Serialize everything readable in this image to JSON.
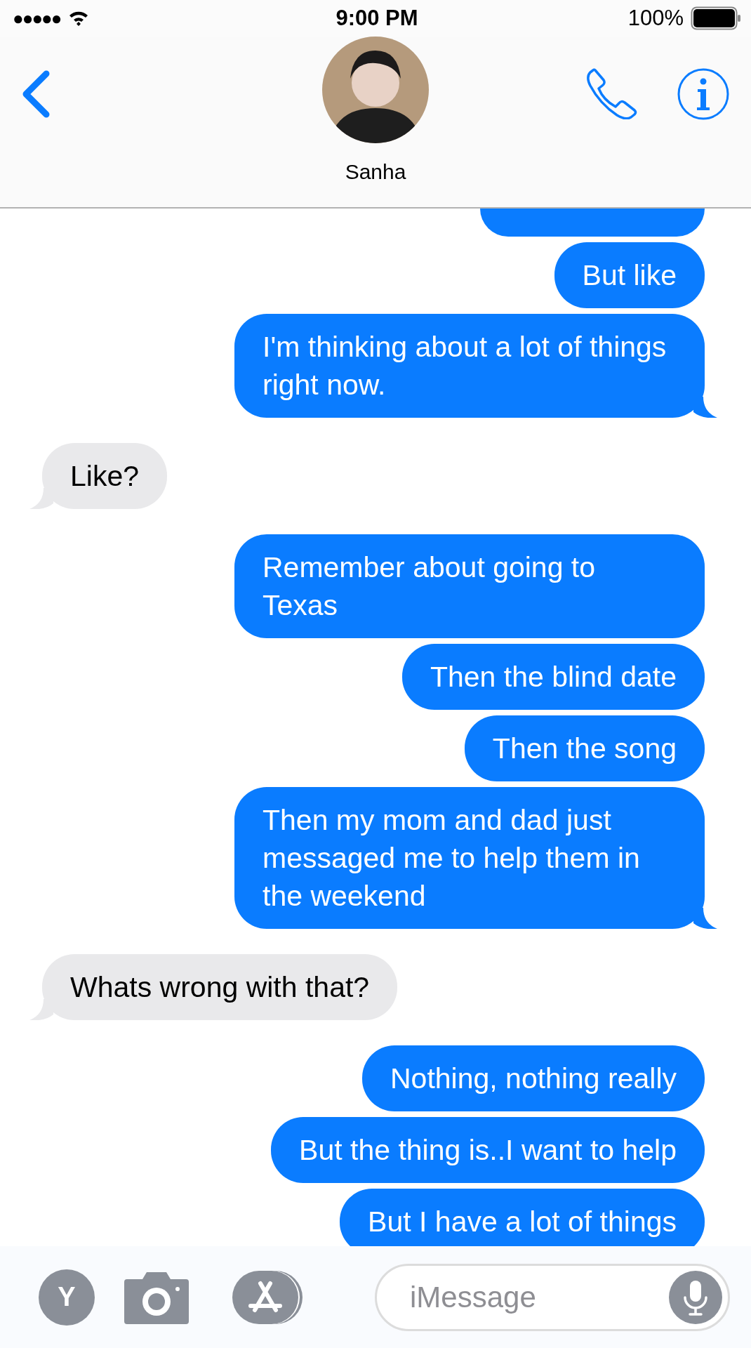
{
  "status_bar": {
    "signal_dots": "●●●●●",
    "time": "9:00 PM",
    "battery": "100%"
  },
  "header": {
    "contact_name": "Sanha"
  },
  "messages": [
    {
      "outgoing": true,
      "kind": "clipped",
      "tail": false
    },
    {
      "outgoing": true,
      "kind": "text",
      "text": "But like",
      "tail": false
    },
    {
      "outgoing": true,
      "kind": "text",
      "text": "I'm thinking about a lot of things right now.",
      "tail": true
    },
    {
      "outgoing": false,
      "kind": "text",
      "text": "Like?",
      "tail": true
    },
    {
      "outgoing": true,
      "kind": "text",
      "text": "Remember about going to Texas",
      "tail": false
    },
    {
      "outgoing": true,
      "kind": "text",
      "text": "Then the blind date",
      "tail": false
    },
    {
      "outgoing": true,
      "kind": "text",
      "text": "Then the song",
      "tail": false
    },
    {
      "outgoing": true,
      "kind": "text",
      "text": "Then my mom and dad just messaged me to help them in the weekend",
      "tail": true
    },
    {
      "outgoing": false,
      "kind": "text",
      "text": "Whats wrong with that?",
      "tail": true
    },
    {
      "outgoing": true,
      "kind": "text",
      "text": "Nothing, nothing really",
      "tail": false
    },
    {
      "outgoing": true,
      "kind": "text",
      "text": "But the thing is..I want to help",
      "tail": false
    },
    {
      "outgoing": true,
      "kind": "text",
      "text": "But I have a lot of things",
      "tail": false
    }
  ],
  "composer": {
    "app_button": "Y",
    "placeholder": "iMessage"
  }
}
